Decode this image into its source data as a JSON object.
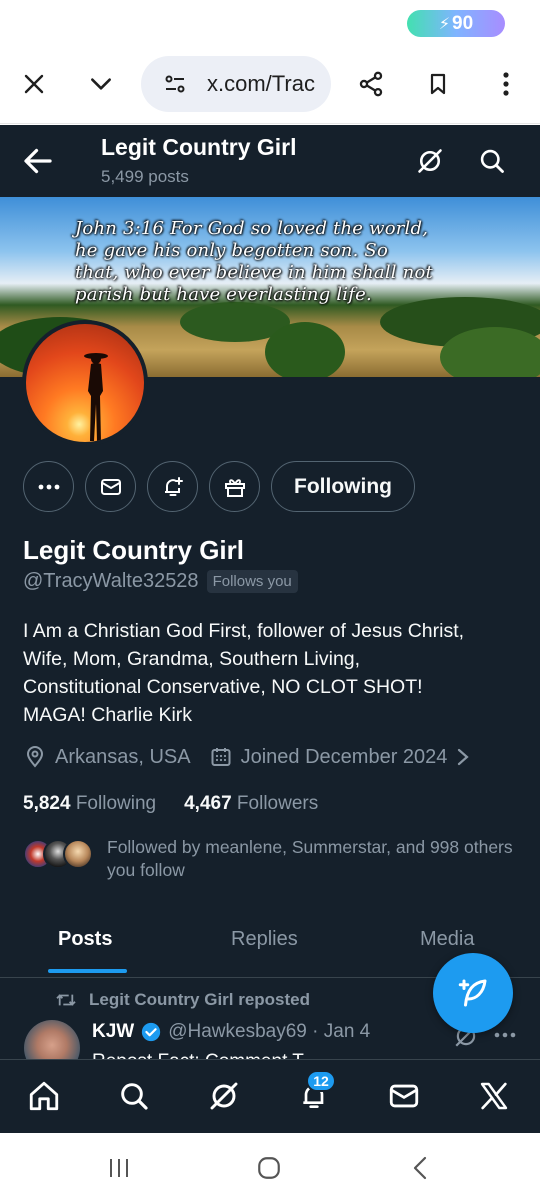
{
  "status_bar": {
    "battery_level": "90"
  },
  "browser": {
    "url": "x.com/Trac"
  },
  "topbar": {
    "title": "Legit Country Girl",
    "posts_count": "5,499 posts"
  },
  "banner": {
    "lines": [
      "John 3:16 For God so loved the world,",
      "he gave his only begotten son. So",
      "that, who ever believe in him shall not",
      "parish but have everlasting life."
    ]
  },
  "profile": {
    "following_button": "Following",
    "name": "Legit Country Girl",
    "handle": "@TracyWalte32528",
    "follows_you": "Follows you",
    "bio_lines": [
      "I Am a Christian God First, follower of Jesus Christ,",
      "Wife, Mom, Grandma, Southern Living,",
      "Constitutional Conservative, NO CLOT SHOT!",
      "MAGA!  Charlie Kirk"
    ],
    "location": "Arkansas, USA",
    "joined": "Joined December 2024",
    "following_count": "5,824",
    "following_label": "Following",
    "followers_count": "4,467",
    "followers_label": "Followers",
    "followed_by": "Followed by meanlene, Summerstar, and 998 others you follow"
  },
  "tabs": [
    "Posts",
    "Replies",
    "Media"
  ],
  "post": {
    "reposted_by": "Legit Country Girl reposted",
    "author": "KJW",
    "handle": "@Hawkesbay69 · Jan 4",
    "text": "Repost Fact: Comment T..."
  },
  "nav": {
    "notifications_badge": "12"
  },
  "colors": {
    "accent": "#1d9bf0",
    "background": "#15202b",
    "muted": "#8b98a5"
  }
}
